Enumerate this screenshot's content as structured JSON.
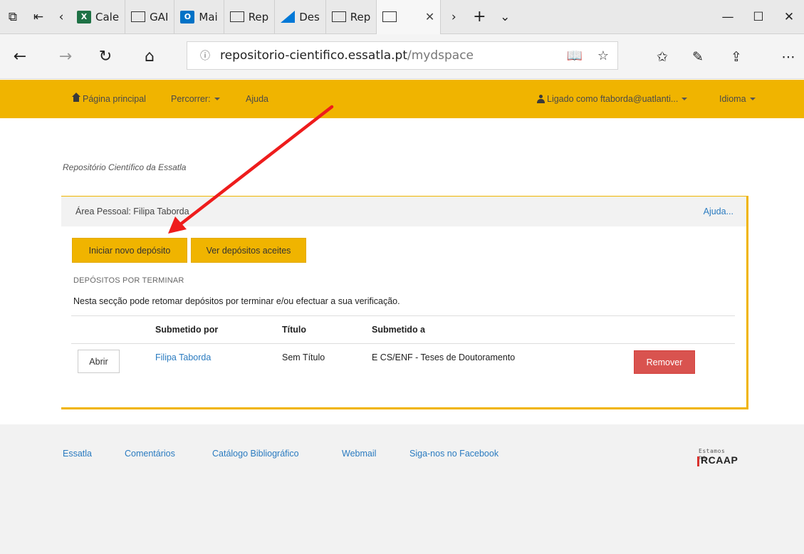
{
  "browser": {
    "tabs": [
      {
        "label": "Cale",
        "icon": "excel-icon"
      },
      {
        "label": "GAI",
        "icon": "page-icon"
      },
      {
        "label": "Mai",
        "icon": "outlook-icon"
      },
      {
        "label": "Rep",
        "icon": "page-icon"
      },
      {
        "label": "Des",
        "icon": "azure-icon"
      },
      {
        "label": "Rep",
        "icon": "page-icon"
      }
    ],
    "url_info": "ⓘ",
    "url_host": "repositorio-cientifico.essatla.pt",
    "url_path": "/mydspace"
  },
  "nav": {
    "home": "Página principal",
    "browse": "Percorrer:",
    "help": "Ajuda",
    "logged_in": "Ligado como ftaborda@uatlanti...",
    "language": "Idioma"
  },
  "breadcrumb": "Repositório Científico da Essatla",
  "panel": {
    "title": "Área Pessoal: Filipa Taborda",
    "help": "Ajuda...",
    "start_button": "Iniciar novo depósito",
    "accepted_button": "Ver depósitos aceites",
    "section_title": "DEPÓSITOS POR TERMINAR",
    "section_desc": "Nesta secção pode retomar depósitos por terminar e/ou efectuar a sua verificação.",
    "table": {
      "headers": [
        "Submetido por",
        "Título",
        "Submetido a"
      ],
      "rows": [
        {
          "open": "Abrir",
          "submitter": "Filipa Taborda",
          "title": "Sem Título",
          "collection": "E CS/ENF - Teses de Doutoramento",
          "remove": "Remover"
        }
      ]
    }
  },
  "footer": {
    "links": [
      "Essatla",
      "Comentários",
      "Catálogo Bibliográfico",
      "Webmail",
      "Siga-nos no Facebook"
    ],
    "badge_small": "Estamos no",
    "badge_big": "RCAAP"
  },
  "colors": {
    "accent": "#f0b400",
    "link": "#2a7bc0",
    "danger": "#d9534f",
    "annotation": "#ee1c1c"
  }
}
